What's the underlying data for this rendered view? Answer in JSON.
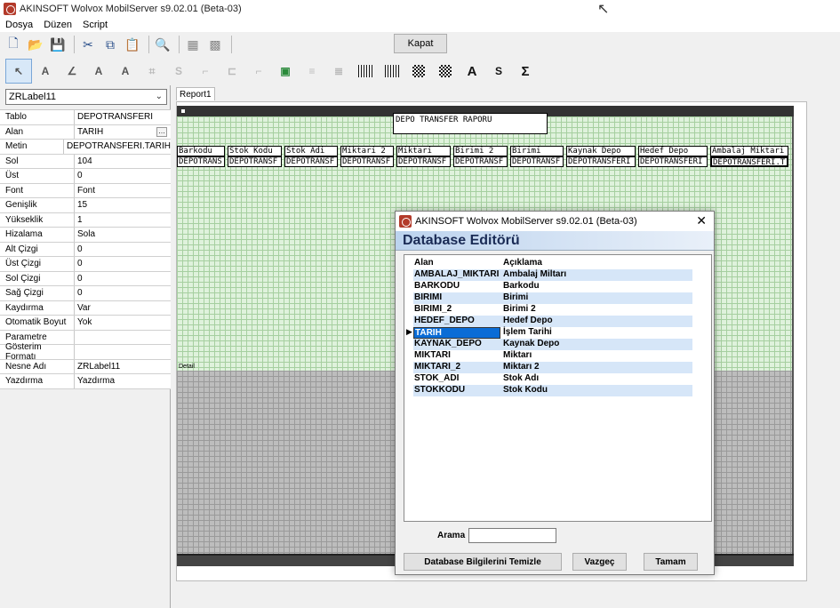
{
  "window": {
    "title": "AKINSOFT Wolvox MobilServer s9.02.01 (Beta-03)"
  },
  "menu": {
    "items": [
      "Dosya",
      "Düzen",
      "Script"
    ]
  },
  "toolbar": {
    "close_label": "Kapat"
  },
  "component_select": {
    "value": "ZRLabel11"
  },
  "properties": [
    {
      "key": "Tablo",
      "value": "DEPOTRANSFERI"
    },
    {
      "key": "Alan",
      "value": "TARIH"
    },
    {
      "key": "Metin",
      "value": "DEPOTRANSFERI.TARIH"
    },
    {
      "key": "Sol",
      "value": "104"
    },
    {
      "key": "Üst",
      "value": "0"
    },
    {
      "key": "Font",
      "value": "Font"
    },
    {
      "key": "Genişlik",
      "value": "15"
    },
    {
      "key": "Yükseklik",
      "value": "1"
    },
    {
      "key": "Hizalama",
      "value": "Sola"
    },
    {
      "key": "Alt Çizgi",
      "value": "0"
    },
    {
      "key": "Üst Çizgi",
      "value": "0"
    },
    {
      "key": "Sol Çizgi",
      "value": "0"
    },
    {
      "key": "Sağ Çizgi",
      "value": "0"
    },
    {
      "key": "Kaydırma",
      "value": "Var"
    },
    {
      "key": "Otomatik Boyut",
      "value": "Yok"
    },
    {
      "key": "Parametre",
      "value": ""
    },
    {
      "key": "Gösterim Formatı",
      "value": ""
    },
    {
      "key": "Nesne Adı",
      "value": "ZRLabel11"
    },
    {
      "key": "Yazdırma",
      "value": "Yazdırma"
    }
  ],
  "report": {
    "tab_label": "Report1",
    "title": "DEPO TRANSFER RAPORU",
    "detail_label": "Detail",
    "headers": [
      "Barkodu",
      "Stok Kodu",
      "Stok Adi",
      "Miktari 2",
      "Miktari",
      "Birimi 2",
      "Birimi",
      "Kaynak Depo",
      "Hedef Depo",
      "Ambalaj Miktari"
    ],
    "fields": [
      "DEPOTRANS",
      "DEPOTRANSF",
      "DEPOTRANSF",
      "DEPOTRANSF",
      "DEPOTRANSF",
      "DEPOTRANSF",
      "DEPOTRANSF",
      "DEPOTRANSFERI",
      "DEPOTRANSFERI",
      "DEPOTRANSFERI.T"
    ]
  },
  "dialog": {
    "window_title": "AKINSOFT Wolvox MobilServer s9.02.01 (Beta-03)",
    "header": "Database Editörü",
    "columns": {
      "field": "Alan",
      "desc": "Açıklama"
    },
    "rows": [
      {
        "field": "AMBALAJ_MIKTARI",
        "desc": "Ambalaj Miltarı"
      },
      {
        "field": "BARKODU",
        "desc": "Barkodu"
      },
      {
        "field": "BIRIMI",
        "desc": "Birimi"
      },
      {
        "field": "BIRIMI_2",
        "desc": "Birimi 2"
      },
      {
        "field": "HEDEF_DEPO",
        "desc": "Hedef Depo"
      },
      {
        "field": "TARIH",
        "desc": "İşlem Tarihi"
      },
      {
        "field": "KAYNAK_DEPO",
        "desc": "Kaynak Depo"
      },
      {
        "field": "MIKTARI",
        "desc": "Miktarı"
      },
      {
        "field": "MIKTARI_2",
        "desc": "Miktarı 2"
      },
      {
        "field": "STOK_ADI",
        "desc": "Stok Adı"
      },
      {
        "field": "STOKKODU",
        "desc": "Stok Kodu"
      }
    ],
    "search_label": "Arama",
    "search_value": "",
    "buttons": {
      "clear": "Database Bilgilerini Temizle",
      "cancel": "Vazgeç",
      "ok": "Tamam"
    }
  }
}
